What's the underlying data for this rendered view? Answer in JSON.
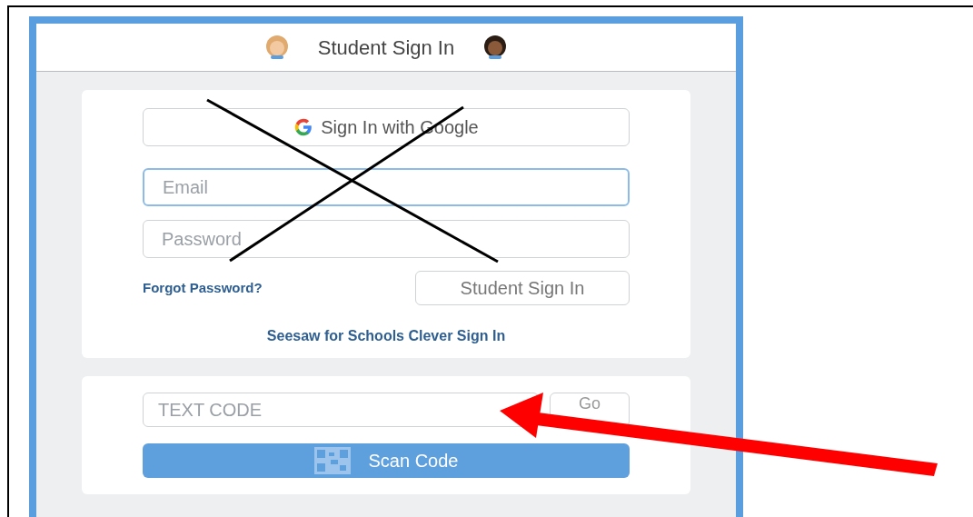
{
  "header": {
    "title": "Student Sign In"
  },
  "sign_in_card": {
    "google_button": "Sign In with Google",
    "email": {
      "placeholder": "Email",
      "focused": true
    },
    "password": {
      "placeholder": "Password",
      "focused": false
    },
    "forgot_link": "Forgot Password?",
    "submit_button": "Student Sign In",
    "clever_link": "Seesaw for Schools Clever Sign In"
  },
  "code_card": {
    "code_field": {
      "placeholder": "TEXT CODE"
    },
    "go_button": "Go",
    "scan_button": "Scan Code"
  }
}
